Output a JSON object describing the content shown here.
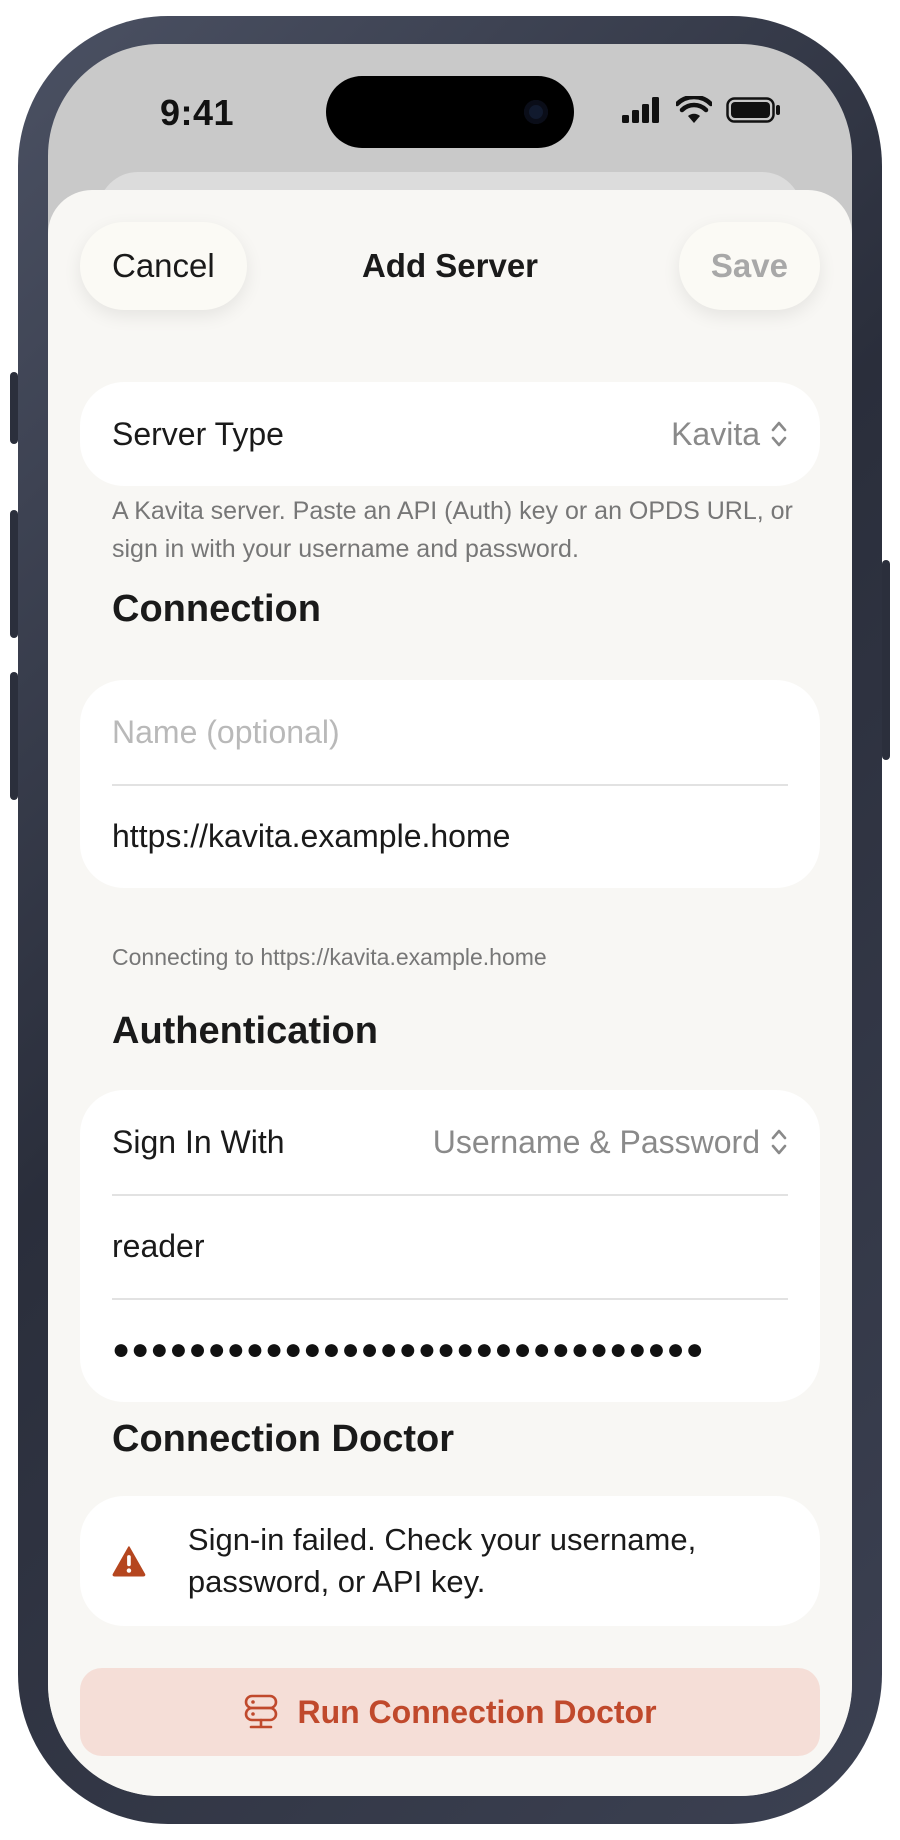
{
  "status_bar": {
    "time": "9:41"
  },
  "nav": {
    "cancel": "Cancel",
    "title": "Add Server",
    "save": "Save"
  },
  "server_type": {
    "label": "Server Type",
    "value": "Kavita",
    "description": "A Kavita server. Paste an API (Auth) key or an OPDS URL, or sign in with your username and password."
  },
  "connection": {
    "title": "Connection",
    "name_placeholder": "Name (optional)",
    "url_value": "https://kavita.example.home",
    "footnote": "Connecting to https://kavita.example.home"
  },
  "authentication": {
    "title": "Authentication",
    "sign_in_label": "Sign In With",
    "sign_in_value": "Username & Password",
    "username_value": "reader",
    "password_value": "●●●●●●●●●●●●●●●●●●●●●●●●●●●●●●●"
  },
  "doctor": {
    "title": "Connection Doctor",
    "message": "Sign-in failed. Check your username, password, or API key.",
    "run_button": "Run Connection Doctor"
  },
  "colors": {
    "accent": "#c0492c",
    "warning": "#b5461f",
    "run_bg": "#f5ded7",
    "sheet_bg": "#f8f7f4"
  }
}
